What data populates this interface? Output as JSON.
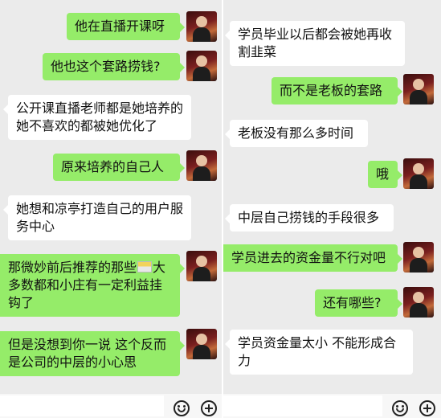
{
  "left_panel": {
    "messages": [
      {
        "sender": "self",
        "text": "他在直播开课呀"
      },
      {
        "sender": "self",
        "text": "他也这个套路捞钱?"
      },
      {
        "sender": "other",
        "text": "公开课直播老师都是她培养的 她不喜欢的都被她优化了"
      },
      {
        "sender": "self",
        "text": "原来培养的自己人"
      },
      {
        "sender": "other",
        "text": "她想和凉亭打造自己的用户服务中心"
      },
      {
        "sender": "self",
        "text_before": "那微妙前后推荐的那些",
        "inline_icon": "emoji-sticker-icon",
        "text_after": "大多数都和小庄有一定利益挂钩了"
      },
      {
        "sender": "self",
        "text": "但是没想到你一说 这个反而是公司的中层的小心思"
      }
    ]
  },
  "right_panel": {
    "messages": [
      {
        "sender": "other",
        "text": "学员毕业以后都会被她再收割韭菜"
      },
      {
        "sender": "self",
        "text": "而不是老板的套路"
      },
      {
        "sender": "other",
        "text": "老板没有那么多时间"
      },
      {
        "sender": "self",
        "text": "哦"
      },
      {
        "sender": "other",
        "text": "中层自己捞钱的手段很多"
      },
      {
        "sender": "self",
        "text": "学员进去的资金量不行对吧"
      },
      {
        "sender": "self",
        "text": "还有哪些?"
      },
      {
        "sender": "other",
        "text": "学员资金量太小 不能形成合力"
      }
    ]
  },
  "input_bar": {
    "icons": [
      "smile-icon",
      "plus-icon"
    ]
  },
  "colors": {
    "background": "#ebebeb",
    "self_bubble": "#95ec69",
    "other_bubble": "#ffffff"
  }
}
